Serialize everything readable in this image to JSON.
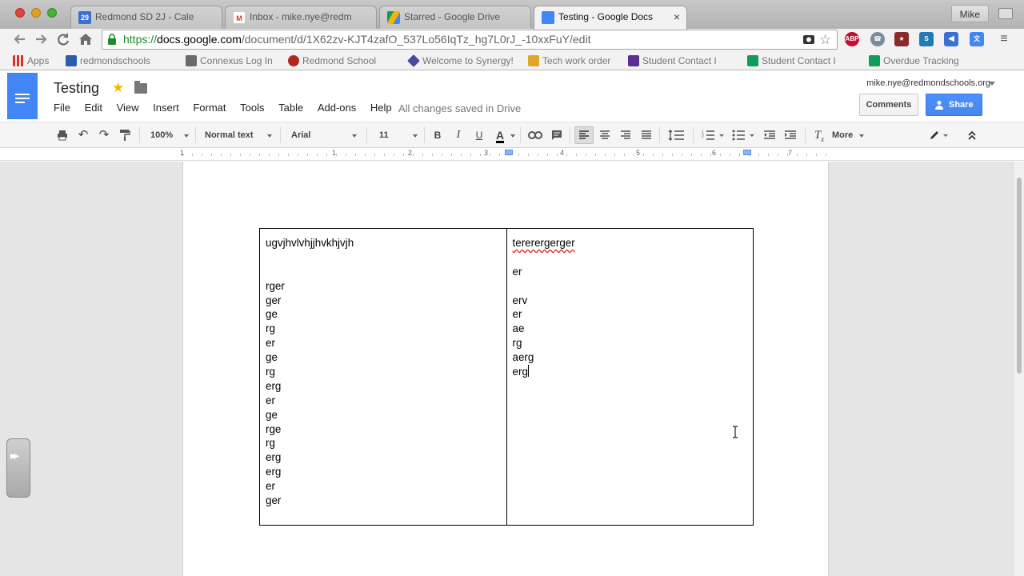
{
  "window": {
    "profile_name": "Mike",
    "tabs": [
      {
        "label": "Redmond SD 2J - Cale",
        "favicon": "calendar-icon",
        "favicon_text": "29",
        "favicon_color": "#3b6fd4"
      },
      {
        "label": "Inbox - mike.nye@redm",
        "favicon": "gmail-icon",
        "favicon_color": "#d93025"
      },
      {
        "label": "Starred - Google Drive",
        "favicon": "drive-icon",
        "favicon_color": "#0f9d58"
      },
      {
        "label": "Testing - Google Docs",
        "favicon": "docs-icon",
        "favicon_color": "#4285f4",
        "active": true,
        "close": "×"
      }
    ]
  },
  "omnibox": {
    "scheme": "https://",
    "host": "docs.google.com",
    "path": "/document/d/1X62zv-KJT4zafO_537Lo56IqTz_hg7L0rJ_-10xxFuY/edit",
    "extensions": [
      {
        "name": "abp-icon",
        "text": "ABP",
        "color": "#c70d2c"
      },
      {
        "name": "phone-icon",
        "text": "☎",
        "color": "#7a8c98"
      },
      {
        "name": "bookmark-manager-icon",
        "text": "★",
        "color": "#8b2a2a"
      },
      {
        "name": "s-extension-icon",
        "text": "S",
        "color": "#1f7bb6"
      },
      {
        "name": "megaphone-icon",
        "text": "📣",
        "color": "#3b6fd4"
      },
      {
        "name": "translate-icon",
        "text": "文",
        "color": "#4285f4"
      }
    ]
  },
  "bookmarks": [
    {
      "label": "Apps",
      "color": "#d93025"
    },
    {
      "label": "redmondschools",
      "color": "#2a5db0"
    },
    {
      "label": "Connexus Log In",
      "color": "#6b6b6b"
    },
    {
      "label": "Redmond School",
      "color": "#b3261e"
    },
    {
      "label": "Welcome to Synergy!",
      "color": "#4a4a9c"
    },
    {
      "label": "Tech work order",
      "color": "#e0a526"
    },
    {
      "label": "Student Contact I",
      "color": "#5b2e91"
    },
    {
      "label": "Student Contact I",
      "color": "#0f9d58"
    },
    {
      "label": "Overdue Tracking",
      "color": "#0f9d58"
    }
  ],
  "docs": {
    "title": "Testing",
    "menus": [
      "File",
      "Edit",
      "View",
      "Insert",
      "Format",
      "Tools",
      "Table",
      "Add-ons",
      "Help"
    ],
    "save_status": "All changes saved in Drive",
    "account": "mike.nye@redmondschools.org",
    "comments_label": "Comments",
    "share_label": "Share",
    "brand_color": "#4285f4"
  },
  "toolbar": {
    "zoom": "100%",
    "style": "Normal text",
    "font": "Arial",
    "size": "11",
    "bold": "B",
    "italic": "I",
    "underline": "U",
    "text_color": "A",
    "more": "More"
  },
  "ruler": {
    "numbers": [
      "1",
      "1",
      "2",
      "3",
      "4",
      "5",
      "6",
      "7"
    ]
  },
  "table": {
    "left_cell": [
      "ugvjhvlvhjjhvkhjvjh",
      "",
      "",
      "rger",
      "ger",
      "ge",
      "rg",
      "er",
      "ge",
      "rg",
      "erg",
      "er",
      "ge",
      "rge",
      "rg",
      "erg",
      "erg",
      "er",
      "ger"
    ],
    "right_cell": [
      "tererergerger",
      "",
      "er",
      "",
      "erv",
      "er",
      "ae",
      "rg",
      "aerg",
      "erg"
    ]
  }
}
